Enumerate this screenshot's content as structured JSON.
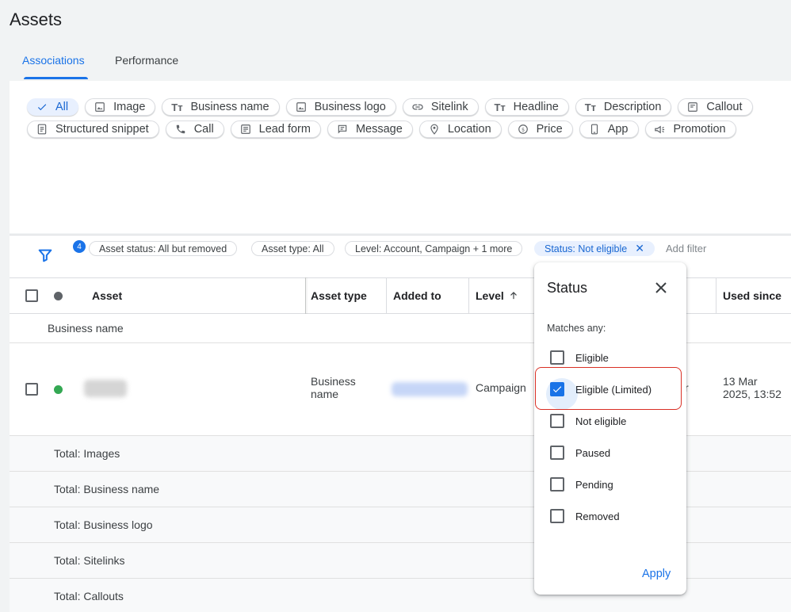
{
  "page": {
    "title": "Assets"
  },
  "tabs": [
    {
      "label": "Associations",
      "active": true
    },
    {
      "label": "Performance",
      "active": false
    }
  ],
  "chips": {
    "row1": [
      {
        "label": "All",
        "icon": "check-icon",
        "selected": true
      },
      {
        "label": "Image",
        "icon": "image-icon"
      },
      {
        "label": "Business name",
        "icon": "text-icon"
      },
      {
        "label": "Business logo",
        "icon": "image-icon"
      },
      {
        "label": "Sitelink",
        "icon": "link-icon"
      },
      {
        "label": "Headline",
        "icon": "text-icon"
      },
      {
        "label": "Description",
        "icon": "text-icon"
      },
      {
        "label": "Callout",
        "icon": "callout-icon"
      }
    ],
    "row2": [
      {
        "label": "Structured snippet",
        "icon": "snippet-icon"
      },
      {
        "label": "Call",
        "icon": "phone-icon"
      },
      {
        "label": "Lead form",
        "icon": "form-icon"
      },
      {
        "label": "Message",
        "icon": "message-icon"
      },
      {
        "label": "Location",
        "icon": "location-pin-icon"
      },
      {
        "label": "Price",
        "icon": "price-icon"
      },
      {
        "label": "App",
        "icon": "phone-device-icon"
      },
      {
        "label": "Promotion",
        "icon": "megaphone-icon"
      }
    ]
  },
  "filters": {
    "badge_count": "4",
    "chips": [
      "Asset status: All but removed",
      "Asset type: All",
      "Level: Account, Campaign + 1 more",
      "Status: Not eligible"
    ],
    "add_filter": "Add filter"
  },
  "table": {
    "headers": {
      "asset": "Asset",
      "asset_type": "Asset type",
      "added_to": "Added to",
      "level": "Level",
      "used_since": "Used since"
    },
    "sort_icon": "arrow-up-icon",
    "group_label": "Business name",
    "row": {
      "status_color": "#34a853",
      "asset_type_line1": "Business",
      "asset_type_line2": "name",
      "level": "Campaign",
      "partial_status": "r",
      "used_since_line1": "13 Mar",
      "used_since_line2": "2025, 13:52"
    },
    "totals": [
      "Total: Images",
      "Total: Business name",
      "Total: Business logo",
      "Total: Sitelinks",
      "Total: Callouts"
    ]
  },
  "status_popover": {
    "title": "Status",
    "subtitle": "Matches any:",
    "options": [
      {
        "label": "Eligible",
        "checked": false
      },
      {
        "label": "Eligible (Limited)",
        "checked": true
      },
      {
        "label": "Not eligible",
        "checked": false
      },
      {
        "label": "Paused",
        "checked": false
      },
      {
        "label": "Pending",
        "checked": false
      },
      {
        "label": "Removed",
        "checked": false
      }
    ],
    "apply_label": "Apply"
  },
  "colors": {
    "accent": "#1a73e8",
    "highlight": "#d93025",
    "status_enabled": "#34a853"
  }
}
